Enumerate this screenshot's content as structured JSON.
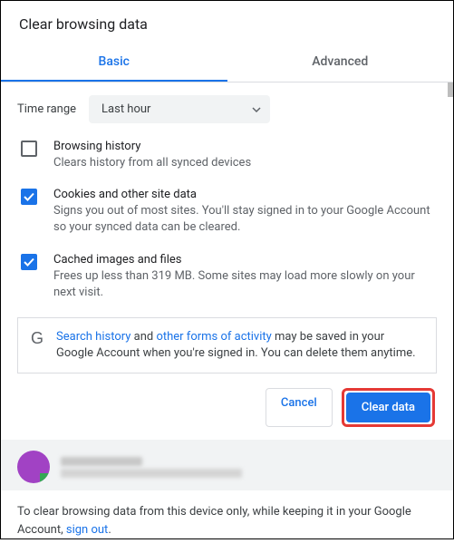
{
  "title": "Clear browsing data",
  "tabs": {
    "basic": "Basic",
    "advanced": "Advanced"
  },
  "timeRange": {
    "label": "Time range",
    "value": "Last hour"
  },
  "options": [
    {
      "title": "Browsing history",
      "desc": "Clears history from all synced devices",
      "checked": false
    },
    {
      "title": "Cookies and other site data",
      "desc": "Signs you out of most sites. You'll stay signed in to your Google Account so your synced data can be cleared.",
      "checked": true
    },
    {
      "title": "Cached images and files",
      "desc": "Frees up less than 319 MB. Some sites may load more slowly on your next visit.",
      "checked": true
    }
  ],
  "info": {
    "link1": "Search history",
    "mid1": " and ",
    "link2": "other forms of activity",
    "rest": " may be saved in your Google Account when you're signed in. You can delete them anytime."
  },
  "buttons": {
    "cancel": "Cancel",
    "clear": "Clear data"
  },
  "footer": {
    "pre": "To clear browsing data from this device only, while keeping it in your Google Account, ",
    "link": "sign out",
    "post": "."
  }
}
